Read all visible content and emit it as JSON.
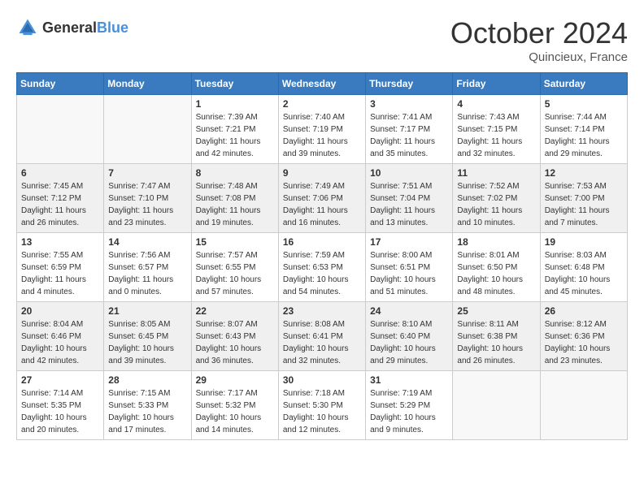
{
  "header": {
    "logo_general": "General",
    "logo_blue": "Blue",
    "month_title": "October 2024",
    "location": "Quincieux, France"
  },
  "weekdays": [
    "Sunday",
    "Monday",
    "Tuesday",
    "Wednesday",
    "Thursday",
    "Friday",
    "Saturday"
  ],
  "weeks": [
    [
      {
        "day": "",
        "info": ""
      },
      {
        "day": "",
        "info": ""
      },
      {
        "day": "1",
        "info": "Sunrise: 7:39 AM\nSunset: 7:21 PM\nDaylight: 11 hours and 42 minutes."
      },
      {
        "day": "2",
        "info": "Sunrise: 7:40 AM\nSunset: 7:19 PM\nDaylight: 11 hours and 39 minutes."
      },
      {
        "day": "3",
        "info": "Sunrise: 7:41 AM\nSunset: 7:17 PM\nDaylight: 11 hours and 35 minutes."
      },
      {
        "day": "4",
        "info": "Sunrise: 7:43 AM\nSunset: 7:15 PM\nDaylight: 11 hours and 32 minutes."
      },
      {
        "day": "5",
        "info": "Sunrise: 7:44 AM\nSunset: 7:14 PM\nDaylight: 11 hours and 29 minutes."
      }
    ],
    [
      {
        "day": "6",
        "info": "Sunrise: 7:45 AM\nSunset: 7:12 PM\nDaylight: 11 hours and 26 minutes."
      },
      {
        "day": "7",
        "info": "Sunrise: 7:47 AM\nSunset: 7:10 PM\nDaylight: 11 hours and 23 minutes."
      },
      {
        "day": "8",
        "info": "Sunrise: 7:48 AM\nSunset: 7:08 PM\nDaylight: 11 hours and 19 minutes."
      },
      {
        "day": "9",
        "info": "Sunrise: 7:49 AM\nSunset: 7:06 PM\nDaylight: 11 hours and 16 minutes."
      },
      {
        "day": "10",
        "info": "Sunrise: 7:51 AM\nSunset: 7:04 PM\nDaylight: 11 hours and 13 minutes."
      },
      {
        "day": "11",
        "info": "Sunrise: 7:52 AM\nSunset: 7:02 PM\nDaylight: 11 hours and 10 minutes."
      },
      {
        "day": "12",
        "info": "Sunrise: 7:53 AM\nSunset: 7:00 PM\nDaylight: 11 hours and 7 minutes."
      }
    ],
    [
      {
        "day": "13",
        "info": "Sunrise: 7:55 AM\nSunset: 6:59 PM\nDaylight: 11 hours and 4 minutes."
      },
      {
        "day": "14",
        "info": "Sunrise: 7:56 AM\nSunset: 6:57 PM\nDaylight: 11 hours and 0 minutes."
      },
      {
        "day": "15",
        "info": "Sunrise: 7:57 AM\nSunset: 6:55 PM\nDaylight: 10 hours and 57 minutes."
      },
      {
        "day": "16",
        "info": "Sunrise: 7:59 AM\nSunset: 6:53 PM\nDaylight: 10 hours and 54 minutes."
      },
      {
        "day": "17",
        "info": "Sunrise: 8:00 AM\nSunset: 6:51 PM\nDaylight: 10 hours and 51 minutes."
      },
      {
        "day": "18",
        "info": "Sunrise: 8:01 AM\nSunset: 6:50 PM\nDaylight: 10 hours and 48 minutes."
      },
      {
        "day": "19",
        "info": "Sunrise: 8:03 AM\nSunset: 6:48 PM\nDaylight: 10 hours and 45 minutes."
      }
    ],
    [
      {
        "day": "20",
        "info": "Sunrise: 8:04 AM\nSunset: 6:46 PM\nDaylight: 10 hours and 42 minutes."
      },
      {
        "day": "21",
        "info": "Sunrise: 8:05 AM\nSunset: 6:45 PM\nDaylight: 10 hours and 39 minutes."
      },
      {
        "day": "22",
        "info": "Sunrise: 8:07 AM\nSunset: 6:43 PM\nDaylight: 10 hours and 36 minutes."
      },
      {
        "day": "23",
        "info": "Sunrise: 8:08 AM\nSunset: 6:41 PM\nDaylight: 10 hours and 32 minutes."
      },
      {
        "day": "24",
        "info": "Sunrise: 8:10 AM\nSunset: 6:40 PM\nDaylight: 10 hours and 29 minutes."
      },
      {
        "day": "25",
        "info": "Sunrise: 8:11 AM\nSunset: 6:38 PM\nDaylight: 10 hours and 26 minutes."
      },
      {
        "day": "26",
        "info": "Sunrise: 8:12 AM\nSunset: 6:36 PM\nDaylight: 10 hours and 23 minutes."
      }
    ],
    [
      {
        "day": "27",
        "info": "Sunrise: 7:14 AM\nSunset: 5:35 PM\nDaylight: 10 hours and 20 minutes."
      },
      {
        "day": "28",
        "info": "Sunrise: 7:15 AM\nSunset: 5:33 PM\nDaylight: 10 hours and 17 minutes."
      },
      {
        "day": "29",
        "info": "Sunrise: 7:17 AM\nSunset: 5:32 PM\nDaylight: 10 hours and 14 minutes."
      },
      {
        "day": "30",
        "info": "Sunrise: 7:18 AM\nSunset: 5:30 PM\nDaylight: 10 hours and 12 minutes."
      },
      {
        "day": "31",
        "info": "Sunrise: 7:19 AM\nSunset: 5:29 PM\nDaylight: 10 hours and 9 minutes."
      },
      {
        "day": "",
        "info": ""
      },
      {
        "day": "",
        "info": ""
      }
    ]
  ]
}
